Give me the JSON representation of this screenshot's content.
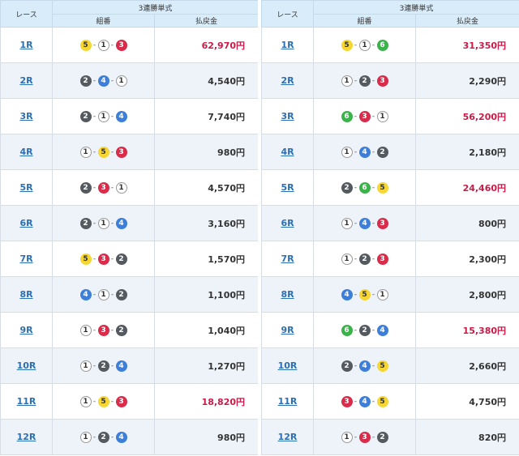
{
  "header": {
    "race": "レース",
    "group": "3連勝単式",
    "combo": "組番",
    "payout": "払戻金"
  },
  "colors": {
    "boat_1": "#ffffff",
    "boat_2": "#555a60",
    "boat_3": "#d92b4a",
    "boat_4": "#3d7fd8",
    "boat_5": "#f5d634",
    "boat_6": "#3bb24a",
    "high_payout": "#cc1a47",
    "link": "#2c6fb3",
    "header_bg": "#d9ecfa"
  },
  "dash": "-",
  "panels": [
    {
      "rows": [
        {
          "race": "1R",
          "combo": [
            "5",
            "1",
            "3"
          ],
          "payout": "62,970円",
          "high": true
        },
        {
          "race": "2R",
          "combo": [
            "2",
            "4",
            "1"
          ],
          "payout": "4,540円",
          "high": false
        },
        {
          "race": "3R",
          "combo": [
            "2",
            "1",
            "4"
          ],
          "payout": "7,740円",
          "high": false
        },
        {
          "race": "4R",
          "combo": [
            "1",
            "5",
            "3"
          ],
          "payout": "980円",
          "high": false
        },
        {
          "race": "5R",
          "combo": [
            "2",
            "3",
            "1"
          ],
          "payout": "4,570円",
          "high": false
        },
        {
          "race": "6R",
          "combo": [
            "2",
            "1",
            "4"
          ],
          "payout": "3,160円",
          "high": false
        },
        {
          "race": "7R",
          "combo": [
            "5",
            "3",
            "2"
          ],
          "payout": "1,570円",
          "high": false
        },
        {
          "race": "8R",
          "combo": [
            "4",
            "1",
            "2"
          ],
          "payout": "1,100円",
          "high": false
        },
        {
          "race": "9R",
          "combo": [
            "1",
            "3",
            "2"
          ],
          "payout": "1,040円",
          "high": false
        },
        {
          "race": "10R",
          "combo": [
            "1",
            "2",
            "4"
          ],
          "payout": "1,270円",
          "high": false
        },
        {
          "race": "11R",
          "combo": [
            "1",
            "5",
            "3"
          ],
          "payout": "18,820円",
          "high": true
        },
        {
          "race": "12R",
          "combo": [
            "1",
            "2",
            "4"
          ],
          "payout": "980円",
          "high": false
        }
      ]
    },
    {
      "rows": [
        {
          "race": "1R",
          "combo": [
            "5",
            "1",
            "6"
          ],
          "payout": "31,350円",
          "high": true
        },
        {
          "race": "2R",
          "combo": [
            "1",
            "2",
            "3"
          ],
          "payout": "2,290円",
          "high": false
        },
        {
          "race": "3R",
          "combo": [
            "6",
            "3",
            "1"
          ],
          "payout": "56,200円",
          "high": true
        },
        {
          "race": "4R",
          "combo": [
            "1",
            "4",
            "2"
          ],
          "payout": "2,180円",
          "high": false
        },
        {
          "race": "5R",
          "combo": [
            "2",
            "6",
            "5"
          ],
          "payout": "24,460円",
          "high": true
        },
        {
          "race": "6R",
          "combo": [
            "1",
            "4",
            "3"
          ],
          "payout": "800円",
          "high": false
        },
        {
          "race": "7R",
          "combo": [
            "1",
            "2",
            "3"
          ],
          "payout": "2,300円",
          "high": false
        },
        {
          "race": "8R",
          "combo": [
            "4",
            "5",
            "1"
          ],
          "payout": "2,800円",
          "high": false
        },
        {
          "race": "9R",
          "combo": [
            "6",
            "2",
            "4"
          ],
          "payout": "15,380円",
          "high": true
        },
        {
          "race": "10R",
          "combo": [
            "2",
            "4",
            "5"
          ],
          "payout": "2,660円",
          "high": false
        },
        {
          "race": "11R",
          "combo": [
            "3",
            "4",
            "5"
          ],
          "payout": "4,750円",
          "high": false
        },
        {
          "race": "12R",
          "combo": [
            "1",
            "3",
            "2"
          ],
          "payout": "820円",
          "high": false
        }
      ]
    }
  ]
}
